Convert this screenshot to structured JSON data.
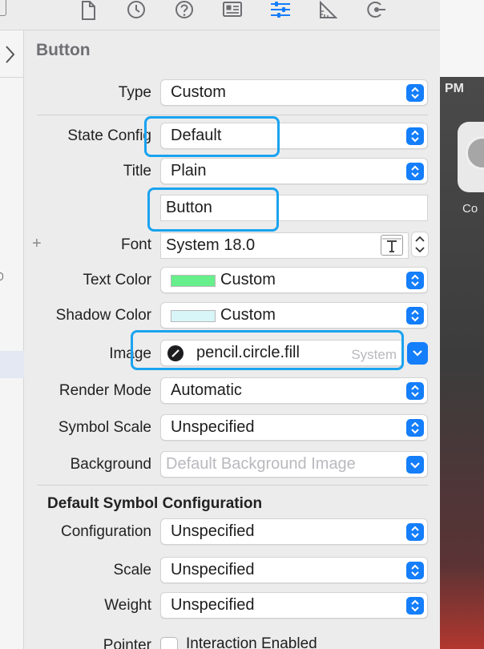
{
  "inspector": {
    "title": "Button",
    "rows": {
      "type": {
        "label": "Type",
        "value": "Custom"
      },
      "state_config": {
        "label": "State Config",
        "value": "Default"
      },
      "title": {
        "label": "Title",
        "value": "Plain"
      },
      "title_text": {
        "value": "Button"
      },
      "font": {
        "label": "Font",
        "value": "System 18.0"
      },
      "text_color": {
        "label": "Text Color",
        "value": "Custom",
        "swatch": "#66ef8a"
      },
      "shadow_color": {
        "label": "Shadow Color",
        "value": "Custom",
        "swatch": "#d8f6f7"
      },
      "image": {
        "label": "Image",
        "value": "pencil.circle.fill",
        "source": "System"
      },
      "render_mode": {
        "label": "Render Mode",
        "value": "Automatic"
      },
      "symbol_scale": {
        "label": "Symbol Scale",
        "value": "Unspecified"
      },
      "background": {
        "label": "Background",
        "placeholder": "Default Background Image"
      }
    },
    "symbol_config": {
      "heading": "Default Symbol Configuration",
      "configuration": {
        "label": "Configuration",
        "value": "Unspecified"
      },
      "scale": {
        "label": "Scale",
        "value": "Unspecified"
      },
      "weight": {
        "label": "Weight",
        "value": "Unspecified"
      }
    },
    "pointer": {
      "label": "Pointer",
      "checkbox_label": "Interaction Enabled"
    },
    "toolbar_icons": [
      "file-inspector-icon",
      "history-inspector-icon",
      "help-inspector-icon",
      "identity-inspector-icon",
      "attributes-inspector-icon",
      "size-inspector-icon",
      "connections-inspector-icon"
    ]
  },
  "desktop": {
    "time_fragment": "PM",
    "app_label_fragment": "Co"
  },
  "colors": {
    "accent": "#147efb",
    "highlight": "#1aa3ef"
  }
}
